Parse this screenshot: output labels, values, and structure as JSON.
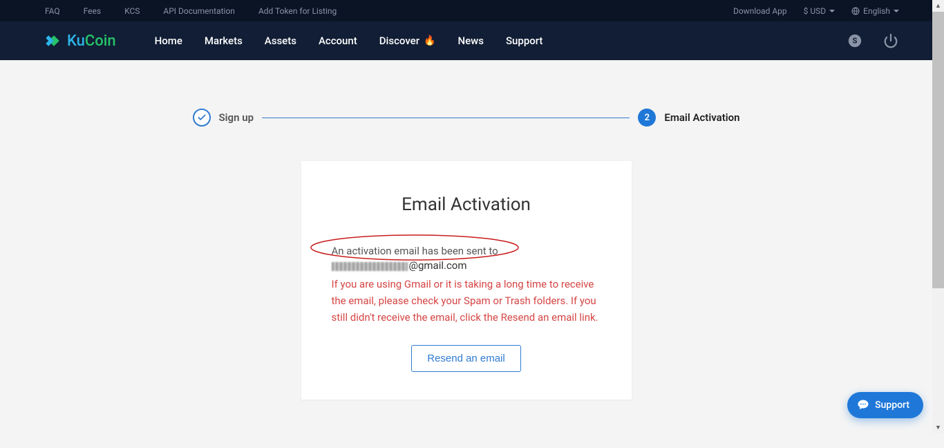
{
  "topbar": {
    "links": [
      "FAQ",
      "Fees",
      "KCS",
      "API Documentation",
      "Add Token for Listing"
    ],
    "download": "Download App",
    "currency": "$  USD",
    "language": "English"
  },
  "nav": {
    "logo": {
      "ku": "Ku",
      "coin": "Coin"
    },
    "items": [
      "Home",
      "Markets",
      "Assets",
      "Account",
      "Discover",
      "News",
      "Support"
    ]
  },
  "steps": {
    "signup": "Sign up",
    "activation": "Email Activation",
    "activation_number": "2"
  },
  "card": {
    "title": "Email Activation",
    "sent_text": "An activation email has been sent to",
    "email_domain": "@gmail.com",
    "warning": "If you are using Gmail or it is taking a long time to receive the email, please check your Spam or Trash folders. If you still didn't receive the email, click the Resend an email link.",
    "resend": "Resend an email"
  },
  "support": {
    "label": "Support"
  }
}
